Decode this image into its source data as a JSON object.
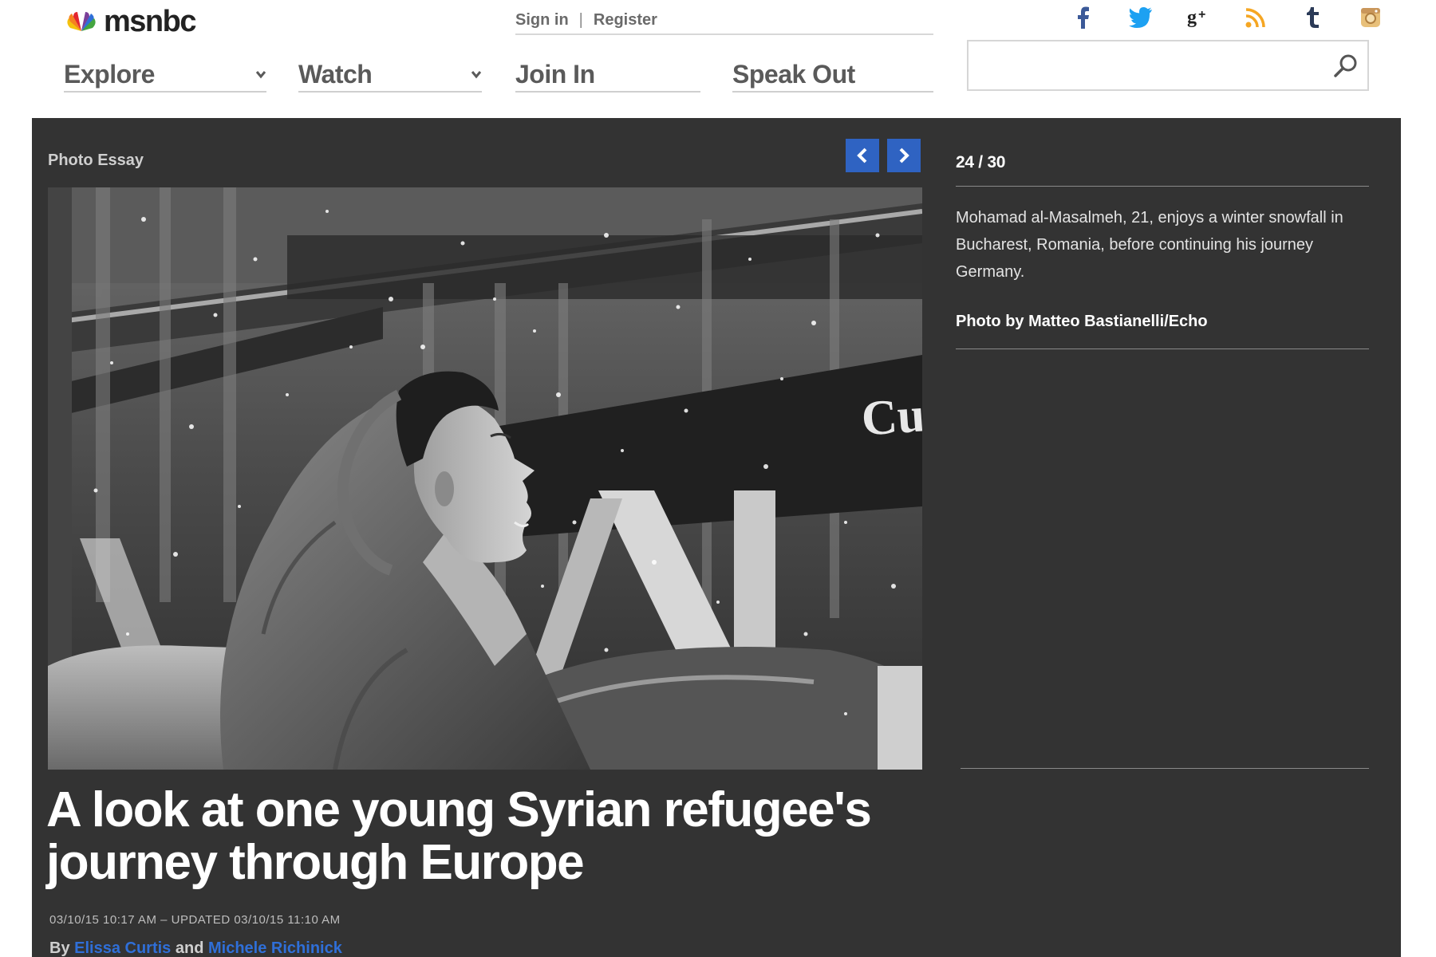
{
  "header": {
    "logo_text": "msnbc",
    "sign_in": "Sign in",
    "separator": "|",
    "register": "Register",
    "nav": [
      {
        "label": "Explore",
        "has_dropdown": true
      },
      {
        "label": "Watch",
        "has_dropdown": true
      },
      {
        "label": "Join In",
        "has_dropdown": false
      },
      {
        "label": "Speak Out",
        "has_dropdown": false
      }
    ],
    "social": [
      {
        "name": "facebook-icon",
        "glyph": "f",
        "color": "#3b5998"
      },
      {
        "name": "twitter-icon",
        "glyph": "",
        "color": "#1da1f2"
      },
      {
        "name": "google-plus-icon",
        "glyph": "g+",
        "color": "#222222"
      },
      {
        "name": "rss-icon",
        "glyph": "",
        "color": "#f5a623"
      },
      {
        "name": "tumblr-icon",
        "glyph": "t",
        "color": "#2b3a57"
      },
      {
        "name": "instagram-icon",
        "glyph": "",
        "color": "#e8c07a"
      }
    ],
    "search": {
      "value": "",
      "placeholder": ""
    }
  },
  "article": {
    "section_label": "Photo Essay",
    "counter": "24 / 30",
    "caption": "Mohamad al-Masalmeh, 21, enjoys a winter snowfall in Bucharest, Romania, before continuing his journey Germany.",
    "credit": "Photo by Matteo Bastianelli/Echo",
    "photo_sign_text": "Cup",
    "headline": "A look at one young Syrian refugee's journey through Europe",
    "dateline": "03/10/15 10:17 AM – UPDATED 03/10/15 11:10 AM",
    "byline_prefix": "By",
    "byline_and": "and",
    "authors": [
      "Elissa Curtis",
      "Michele Richinick"
    ]
  },
  "colors": {
    "panel_bg": "#333333",
    "accent_blue": "#2f63c2",
    "author_link": "#2f6fd8"
  }
}
